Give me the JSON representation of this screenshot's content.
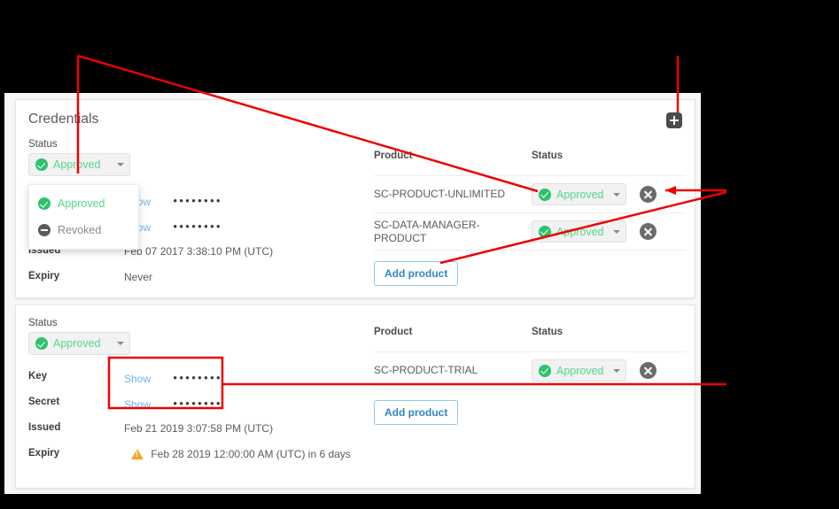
{
  "card": {
    "title": "Credentials",
    "add_credential_icon": "plus-icon"
  },
  "labels": {
    "status": "Status",
    "key": "Key",
    "secret": "Secret",
    "issued": "Issued",
    "expiry": "Expiry",
    "product": "Product",
    "show": "Show",
    "masked_value": "••••••••",
    "add_product": "Add product"
  },
  "status_dropdown": {
    "selected": "Approved",
    "open": true,
    "options": [
      {
        "label": "Approved",
        "icon": "check-circle-icon",
        "color": "#55d68b"
      },
      {
        "label": "Revoked",
        "icon": "minus-circle-icon",
        "color": "#8b8b8b"
      }
    ]
  },
  "credentials": [
    {
      "status": "Approved",
      "key_value": "••••••••",
      "secret_value": "••••••••",
      "issued": "Feb 07 2017 3:38:10 PM (UTC)",
      "expiry": "Never",
      "expiry_warning": false,
      "products": [
        {
          "name": "SC-PRODUCT-UNLIMITED",
          "status": "Approved"
        },
        {
          "name": "SC-DATA-MANAGER-PRODUCT",
          "status": "Approved"
        }
      ]
    },
    {
      "status": "Approved",
      "key_value": "••••••••",
      "secret_value": "••••••••",
      "issued": "Feb 21 2019 3:07:58 PM (UTC)",
      "expiry": "Feb 28 2019 12:00:00 AM (UTC) in 6 days",
      "expiry_warning": true,
      "products": [
        {
          "name": "SC-PRODUCT-TRIAL",
          "status": "Approved"
        }
      ]
    }
  ],
  "colors": {
    "approved_green": "#55d68b",
    "check_green": "#2dc26b",
    "link_blue": "#6cb5e8",
    "button_blue": "#2f87c4",
    "warning_orange": "#f5a623",
    "annotation_red": "#ee0000",
    "background": "#000000"
  }
}
